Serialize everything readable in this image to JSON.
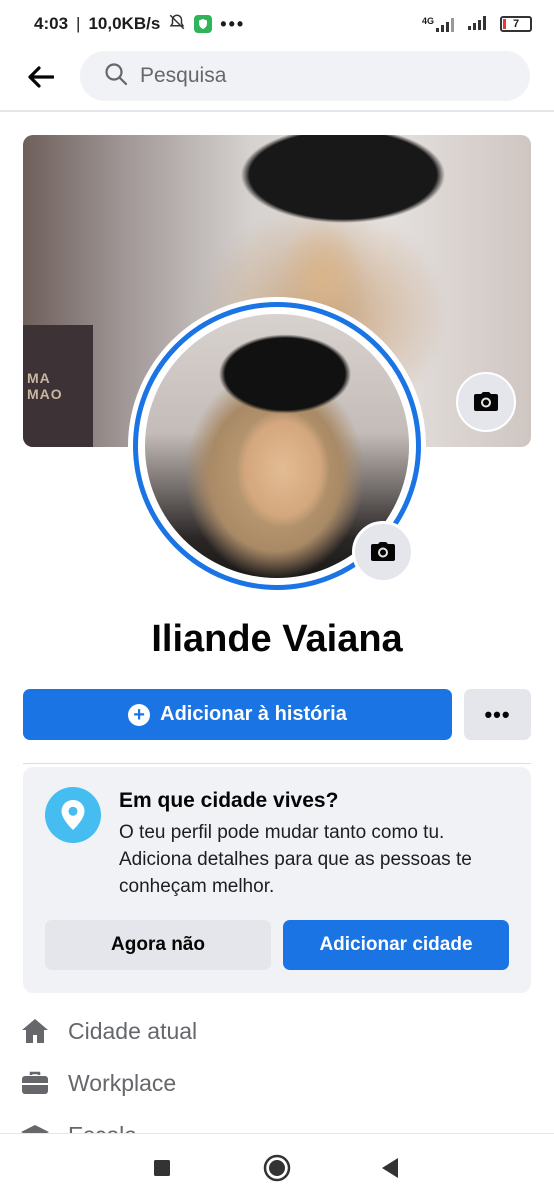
{
  "status_bar": {
    "time": "4:03",
    "speed": "10,0KB/s",
    "network": "4G",
    "battery": "7",
    "battery_level": 0.07
  },
  "search": {
    "placeholder": "Pesquisa"
  },
  "cover": {
    "sign_text": "MA\nMAO"
  },
  "profile": {
    "name": "Iliande Vaiana"
  },
  "actions": {
    "add_story_label": "Adicionar à história",
    "more_label": "•••"
  },
  "city_prompt": {
    "title": "Em que cidade vives?",
    "description": "O teu perfil pode mudar tanto como tu. Adiciona detalhes para que as pessoas te conheçam melhor.",
    "not_now_label": "Agora não",
    "add_city_label": "Adicionar cidade"
  },
  "details": {
    "items": [
      {
        "icon": "home-icon",
        "label": "Cidade atual"
      },
      {
        "icon": "briefcase-icon",
        "label": "Workplace"
      },
      {
        "icon": "school-icon",
        "label": "Escola"
      }
    ]
  },
  "colors": {
    "brand_blue": "#1b74e4",
    "location_blue": "#45bdf0",
    "button_gray": "#e4e6eb",
    "card_gray": "#f0f2f5"
  }
}
